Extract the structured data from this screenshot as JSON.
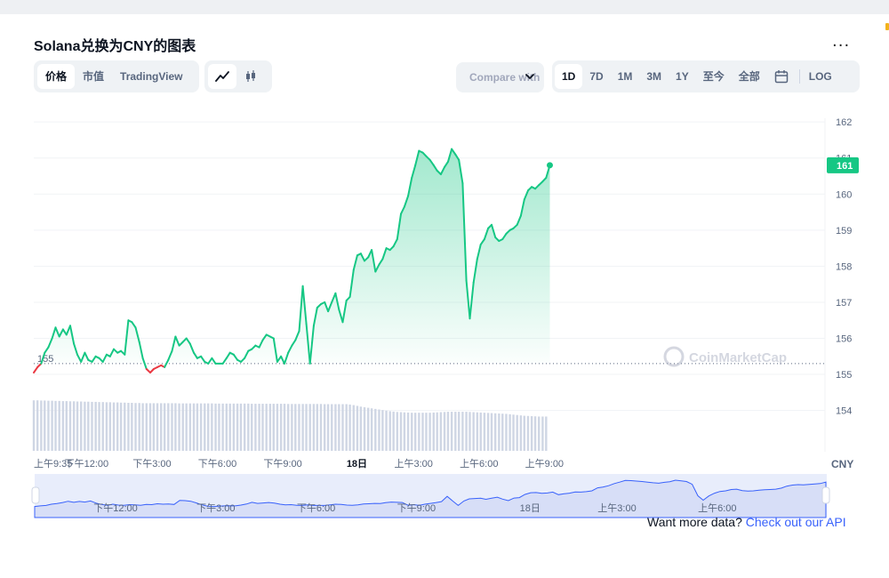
{
  "title": "Solana兑换为CNY的图表",
  "more_label": "...",
  "type_tabs": [
    {
      "label": "价格",
      "active": true
    },
    {
      "label": "市值",
      "active": false
    },
    {
      "label": "TradingView",
      "active": false
    }
  ],
  "chart_types": [
    {
      "icon": "line-chart-icon",
      "active": true
    },
    {
      "icon": "candlestick-icon",
      "active": false
    }
  ],
  "compare_label": "Compare with",
  "ranges": [
    {
      "label": "1D",
      "active": true
    },
    {
      "label": "7D",
      "active": false
    },
    {
      "label": "1M",
      "active": false
    },
    {
      "label": "3M",
      "active": false
    },
    {
      "label": "1Y",
      "active": false
    },
    {
      "label": "至今",
      "active": false
    },
    {
      "label": "全部",
      "active": false
    }
  ],
  "calendar_icon": "calendar-icon",
  "log_label": "LOG",
  "footer": {
    "text": "Want more data?",
    "link": "Check out our API"
  },
  "watermark": "CoinMarketCap",
  "colors": {
    "up": "#16c784",
    "down": "#ea3943",
    "accent": "#3861fb",
    "volume": "#cfd6e4"
  },
  "chart_data": {
    "type": "area",
    "currency": "CNY",
    "ylim": [
      153.3,
      162.3
    ],
    "yticks": [
      162,
      161,
      160,
      159,
      158,
      157,
      156,
      155,
      154
    ],
    "reference_price": 155.3,
    "reference_label": "155",
    "current_price": 160.8,
    "current_label": "161",
    "xlim": [
      9.58,
      45.3
    ],
    "xticks": [
      {
        "x": 9.58,
        "label": "上午9:35",
        "bold": false
      },
      {
        "x": 12,
        "label": "下午12:00",
        "bold": false
      },
      {
        "x": 15,
        "label": "下午3:00",
        "bold": false
      },
      {
        "x": 18,
        "label": "下午6:00",
        "bold": false
      },
      {
        "x": 21,
        "label": "下午9:00",
        "bold": false
      },
      {
        "x": 24.4,
        "label": "18日",
        "bold": true
      },
      {
        "x": 27,
        "label": "上午3:00",
        "bold": false
      },
      {
        "x": 30,
        "label": "上午6:00",
        "bold": false
      },
      {
        "x": 33,
        "label": "上午9:00",
        "bold": false
      }
    ],
    "nav_xticks": [
      {
        "x": 12,
        "label": "下午12:00"
      },
      {
        "x": 15,
        "label": "下午3:00"
      },
      {
        "x": 18,
        "label": "下午6:00"
      },
      {
        "x": 21,
        "label": "下午9:00"
      },
      {
        "x": 24.4,
        "label": "18日"
      },
      {
        "x": 27,
        "label": "上午3:00"
      },
      {
        "x": 30,
        "label": "上午6:00"
      }
    ],
    "series": [
      {
        "name": "价格",
        "x": [
          9.58,
          9.75,
          9.92,
          10.08,
          10.25,
          10.42,
          10.58,
          10.75,
          10.92,
          11.08,
          11.25,
          11.42,
          11.58,
          11.75,
          11.92,
          12.08,
          12.25,
          12.42,
          12.58,
          12.75,
          12.92,
          13.08,
          13.25,
          13.42,
          13.58,
          13.75,
          13.92,
          14.08,
          14.25,
          14.42,
          14.58,
          14.75,
          14.92,
          15.08,
          15.25,
          15.42,
          15.58,
          15.75,
          15.92,
          16.08,
          16.25,
          16.42,
          16.58,
          16.75,
          16.92,
          17.08,
          17.25,
          17.42,
          17.58,
          17.75,
          17.92,
          18.08,
          18.25,
          18.42,
          18.58,
          18.75,
          18.92,
          19.08,
          19.25,
          19.42,
          19.58,
          19.75,
          19.92,
          20.08,
          20.25,
          20.42,
          20.58,
          20.75,
          20.92,
          21.08,
          21.25,
          21.42,
          21.58,
          21.75,
          21.92,
          22.08,
          22.25,
          22.42,
          22.58,
          22.75,
          22.92,
          23.08,
          23.25,
          23.42,
          23.58,
          23.75,
          23.92,
          24.08,
          24.25,
          24.42,
          24.58,
          24.75,
          24.92,
          25.08,
          25.25,
          25.42,
          25.58,
          25.75,
          25.92,
          26.08,
          26.25,
          26.42,
          26.58,
          26.75,
          26.92,
          27.08,
          27.25,
          27.42,
          27.58,
          27.75,
          27.92,
          28.08,
          28.25,
          28.42,
          28.58,
          28.75,
          28.92,
          29.08,
          29.25,
          29.42,
          29.58,
          29.75,
          29.92,
          30.08,
          30.25,
          30.42,
          30.58,
          30.75,
          30.92,
          31.08,
          31.25,
          31.42,
          31.58,
          31.75,
          31.92,
          32.08,
          32.25,
          32.42,
          32.58,
          32.75,
          32.92,
          33.08,
          33.25
        ],
        "y": [
          155.05,
          155.2,
          155.3,
          155.6,
          155.75,
          156.0,
          156.3,
          156.05,
          156.25,
          156.1,
          156.35,
          155.85,
          155.55,
          155.35,
          155.6,
          155.4,
          155.35,
          155.5,
          155.45,
          155.35,
          155.55,
          155.5,
          155.7,
          155.6,
          155.65,
          155.55,
          156.5,
          156.45,
          156.3,
          155.9,
          155.45,
          155.15,
          155.05,
          155.15,
          155.2,
          155.25,
          155.2,
          155.4,
          155.65,
          156.05,
          155.8,
          155.9,
          156.0,
          155.85,
          155.6,
          155.45,
          155.5,
          155.35,
          155.3,
          155.45,
          155.3,
          155.3,
          155.3,
          155.45,
          155.6,
          155.55,
          155.4,
          155.35,
          155.45,
          155.65,
          155.7,
          155.8,
          155.75,
          155.95,
          156.1,
          156.05,
          156.0,
          155.35,
          155.5,
          155.3,
          155.6,
          155.8,
          155.95,
          156.2,
          157.45,
          156.4,
          155.3,
          156.35,
          156.85,
          156.95,
          157.0,
          156.75,
          157.0,
          157.25,
          156.8,
          156.45,
          157.05,
          157.15,
          157.9,
          158.3,
          158.35,
          158.15,
          158.25,
          158.45,
          157.85,
          158.05,
          158.2,
          158.5,
          158.45,
          158.55,
          158.75,
          159.45,
          159.65,
          159.95,
          160.45,
          160.8,
          161.2,
          161.15,
          161.05,
          160.95,
          160.8,
          160.65,
          160.55,
          160.75,
          160.9,
          161.25,
          161.1,
          160.95,
          160.3,
          157.6,
          156.55,
          157.55,
          158.2,
          158.6,
          158.75,
          159.05,
          159.15,
          158.8,
          158.7,
          158.75,
          158.9,
          159.0,
          159.05,
          159.15,
          159.4,
          159.85,
          160.1,
          160.2,
          160.15,
          160.25,
          160.35,
          160.45,
          160.8
        ],
        "volume": [
          26.5,
          26.5,
          26.4,
          26.4,
          26.3,
          26.3,
          26.2,
          26.2,
          26.1,
          26.1,
          26.0,
          26.0,
          25.9,
          25.9,
          25.8,
          25.8,
          25.7,
          25.7,
          25.6,
          25.6,
          25.5,
          25.5,
          25.4,
          25.4,
          25.3,
          25.3,
          25.2,
          25.2,
          25.1,
          25.1,
          25.0,
          25.0,
          25.0,
          25.0,
          25.0,
          25.0,
          25.0,
          25.0,
          25.0,
          25.0,
          24.9,
          24.9,
          24.9,
          24.9,
          24.9,
          24.9,
          24.9,
          24.9,
          24.9,
          24.9,
          24.8,
          24.8,
          24.8,
          24.8,
          24.8,
          24.8,
          24.8,
          24.8,
          24.8,
          24.8,
          24.7,
          24.7,
          24.7,
          24.7,
          24.7,
          24.7,
          24.7,
          24.7,
          24.7,
          24.7,
          24.6,
          24.6,
          24.6,
          24.6,
          24.6,
          24.6,
          24.6,
          24.6,
          24.6,
          24.6,
          24.5,
          24.5,
          24.5,
          24.5,
          24.5,
          24.5,
          24.5,
          24.3,
          24.0,
          23.6,
          23.2,
          22.9,
          22.6,
          22.3,
          22.0,
          21.7,
          21.4,
          21.1,
          20.8,
          20.6,
          20.4,
          20.3,
          20.2,
          20.1,
          20.0,
          20.0,
          20.0,
          20.0,
          20.0,
          20.0,
          20.1,
          20.2,
          20.3,
          20.4,
          20.5,
          20.5,
          20.5,
          20.5,
          20.5,
          20.5,
          20.4,
          20.3,
          20.2,
          20.1,
          20.0,
          19.9,
          19.8,
          19.7,
          19.6,
          19.5,
          19.4,
          19.2,
          19.0,
          18.8,
          18.6,
          18.4,
          18.3,
          18.2,
          18.1,
          18.0,
          18.0,
          18.0
        ]
      }
    ]
  }
}
